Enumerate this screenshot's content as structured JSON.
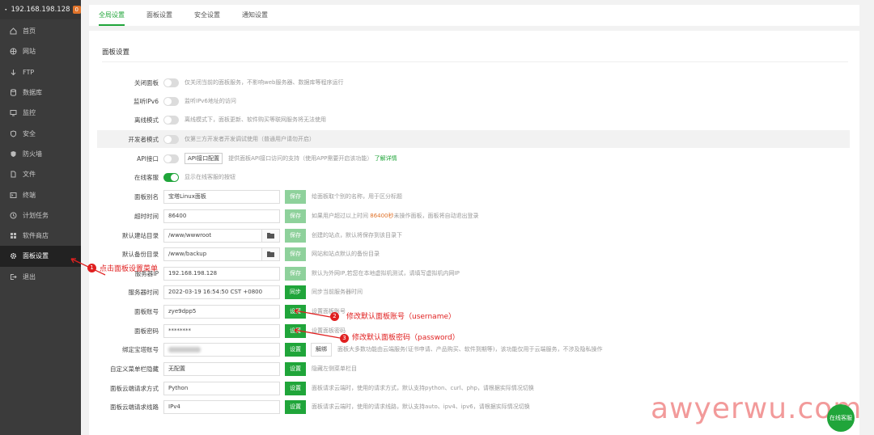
{
  "sidebar": {
    "ip": "192.168.198.128",
    "badge": "0",
    "items": [
      {
        "label": "首页",
        "icon": "home-icon"
      },
      {
        "label": "网站",
        "icon": "globe-icon"
      },
      {
        "label": "FTP",
        "icon": "ftp-icon"
      },
      {
        "label": "数据库",
        "icon": "database-icon"
      },
      {
        "label": "监控",
        "icon": "monitor-icon"
      },
      {
        "label": "安全",
        "icon": "shield-icon"
      },
      {
        "label": "防火墙",
        "icon": "firewall-icon"
      },
      {
        "label": "文件",
        "icon": "file-icon"
      },
      {
        "label": "终端",
        "icon": "terminal-icon"
      },
      {
        "label": "计划任务",
        "icon": "clock-icon"
      },
      {
        "label": "软件商店",
        "icon": "store-icon"
      },
      {
        "label": "面板设置",
        "icon": "gear-icon",
        "active": true
      },
      {
        "label": "退出",
        "icon": "logout-icon"
      }
    ]
  },
  "tabs": [
    "全局设置",
    "面板设置",
    "安全设置",
    "通知设置"
  ],
  "section_title": "面板设置",
  "rows": {
    "close_panel": {
      "label": "关闭面板",
      "desc": "仅关闭当前的面板服务，不影响web服务器、数据库等程序运行"
    },
    "listen_ipv6": {
      "label": "监听IPv6",
      "desc": "监听IPv6地址的访问"
    },
    "offline_mode": {
      "label": "离线模式",
      "desc": "离线模式下，面板更新、软件购买等联网服务将无法使用"
    },
    "dev_mode": {
      "label": "开发者模式",
      "desc": "仅第三方开发者开发调试使用（普通用户请勿开启）"
    },
    "api": {
      "label": "API接口",
      "btn": "API接口配置",
      "desc": "提供面板API接口访问的支持（使用APP需要开启该功能）",
      "link": "了解详情"
    },
    "online_service": {
      "label": "在线客服",
      "desc": "显示在线客服的按钮"
    },
    "alias": {
      "label": "面板别名",
      "value": "宝塔Linux面板",
      "btn": "保存",
      "desc": "给面板取个别的名称，用于区分标题"
    },
    "timeout": {
      "label": "超时时间",
      "value": "86400",
      "btn": "保存",
      "desc_pre": "如果用户超过以上时间",
      "desc_hl": "86400秒",
      "desc_post": "未操作面板，面板将自动退出登录"
    },
    "site_dir": {
      "label": "默认建站目录",
      "value": "/www/wwwroot",
      "btn": "保存",
      "desc": "创建的站点，默认将保存到该目录下"
    },
    "backup_dir": {
      "label": "默认备份目录",
      "value": "/www/backup",
      "btn": "保存",
      "desc": "网站和站点默认的备份目录"
    },
    "server_ip": {
      "label": "服务器IP",
      "value": "192.168.198.128",
      "btn": "保存",
      "desc": "默认为外网IP,若您在本地虚拟机测试，请填写虚拟机内网IP"
    },
    "server_time": {
      "label": "服务器时间",
      "value": "2022-03-19 16:54:50 CST +0800",
      "btn": "同步",
      "desc": "同步当前服务器时间"
    },
    "account": {
      "label": "面板账号",
      "value": "zye9dpp5",
      "btn": "设置",
      "desc": "设置面板账号"
    },
    "password": {
      "label": "面板密码",
      "value": "********",
      "btn": "设置",
      "desc": "设置面板密码"
    },
    "bind_account": {
      "label": "绑定宝塔账号",
      "btn": "设置",
      "btn2": "解绑",
      "desc": "面板大多数功能由云端服务(证书申请、产品购买、软件到期等)，该功能仅用于云端服务，不涉及隐私操作"
    },
    "hidden_menu": {
      "label": "自定义菜单栏隐藏",
      "value": "无配置",
      "btn": "设置",
      "desc": "隐藏左侧菜单栏目"
    },
    "request_method": {
      "label": "面板云端请求方式",
      "value": "Python",
      "btn": "设置",
      "desc": "面板请求云端时，使用的请求方式，默认支持python、curl、php，请根据实际情况切换"
    },
    "request_line": {
      "label": "面板云端请求线路",
      "value": "IPv4",
      "btn": "设置",
      "desc": "面板请求云端时，使用的请求线路，默认支持auto、ipv4、ipv6，请根据实际情况切换"
    }
  },
  "annotations": {
    "a1": {
      "num": "1",
      "text": "点击面板设置菜单"
    },
    "a2": {
      "num": "2",
      "text": "修改默认面板账号（username）"
    },
    "a3": {
      "num": "3",
      "text": "修改默认面板密码（password）"
    }
  },
  "watermark": "awyerwu.com",
  "chat_label": "在线客服",
  "colors": {
    "accent": "#20a53a",
    "annotation": "#e02020",
    "sidebar": "#3b3b3b"
  }
}
